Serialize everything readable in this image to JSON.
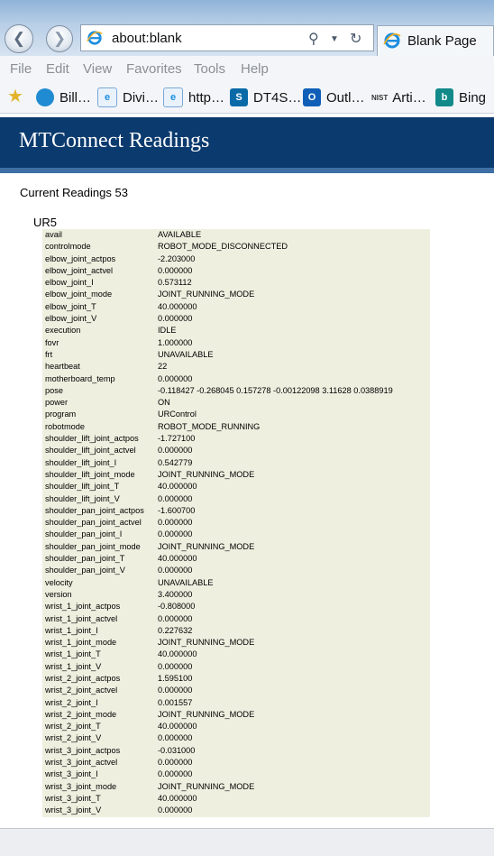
{
  "browser": {
    "address": "about:blank",
    "tab_title": "Blank Page",
    "menu": [
      "File",
      "Edit",
      "View",
      "Favorites",
      "Tools",
      "Help"
    ],
    "favorites": [
      {
        "label": "Bill…",
        "icon": "att-icon"
      },
      {
        "label": "Divi…",
        "icon": "ie-page-icon"
      },
      {
        "label": "http…",
        "icon": "ie-page-icon"
      },
      {
        "label": "DT4S…",
        "icon": "sharepoint-icon"
      },
      {
        "label": "Outl…",
        "icon": "outlook-icon"
      },
      {
        "label": "Arti…",
        "icon": "nist-icon"
      },
      {
        "label": "Bing",
        "icon": "bing-icon"
      }
    ],
    "nist_logo_text": "NIST"
  },
  "page": {
    "title": "MTConnect Readings",
    "current_readings": "Current Readings 53",
    "device": "UR5",
    "readings": [
      [
        "avail",
        "AVAILABLE"
      ],
      [
        "controlmode",
        "ROBOT_MODE_DISCONNECTED"
      ],
      [
        "elbow_joint_actpos",
        "-2.203000"
      ],
      [
        "elbow_joint_actvel",
        "0.000000"
      ],
      [
        "elbow_joint_I",
        "0.573112"
      ],
      [
        "elbow_joint_mode",
        "JOINT_RUNNING_MODE"
      ],
      [
        "elbow_joint_T",
        "40.000000"
      ],
      [
        "elbow_joint_V",
        "0.000000"
      ],
      [
        "execution",
        "IDLE"
      ],
      [
        "fovr",
        "1.000000"
      ],
      [
        "frt",
        "UNAVAILABLE"
      ],
      [
        "heartbeat",
        "22"
      ],
      [
        "motherboard_temp",
        "0.000000"
      ],
      [
        "pose",
        "-0.118427 -0.268045 0.157278 -0.00122098 3.11628 0.0388919"
      ],
      [
        "power",
        "ON"
      ],
      [
        "program",
        "URControl"
      ],
      [
        "robotmode",
        "ROBOT_MODE_RUNNING"
      ],
      [
        "shoulder_lift_joint_actpos",
        "-1.727100"
      ],
      [
        "shoulder_lift_joint_actvel",
        "0.000000"
      ],
      [
        "shoulder_lift_joint_I",
        "0.542779"
      ],
      [
        "shoulder_lift_joint_mode",
        "JOINT_RUNNING_MODE"
      ],
      [
        "shoulder_lift_joint_T",
        "40.000000"
      ],
      [
        "shoulder_lift_joint_V",
        "0.000000"
      ],
      [
        "shoulder_pan_joint_actpos",
        "-1.600700"
      ],
      [
        "shoulder_pan_joint_actvel",
        "0.000000"
      ],
      [
        "shoulder_pan_joint_I",
        "0.000000"
      ],
      [
        "shoulder_pan_joint_mode",
        "JOINT_RUNNING_MODE"
      ],
      [
        "shoulder_pan_joint_T",
        "40.000000"
      ],
      [
        "shoulder_pan_joint_V",
        "0.000000"
      ],
      [
        "velocity",
        "UNAVAILABLE"
      ],
      [
        "version",
        "3.400000"
      ],
      [
        "wrist_1_joint_actpos",
        "-0.808000"
      ],
      [
        "wrist_1_joint_actvel",
        "0.000000"
      ],
      [
        "wrist_1_joint_I",
        "0.227632"
      ],
      [
        "wrist_1_joint_mode",
        "JOINT_RUNNING_MODE"
      ],
      [
        "wrist_1_joint_T",
        "40.000000"
      ],
      [
        "wrist_1_joint_V",
        "0.000000"
      ],
      [
        "wrist_2_joint_actpos",
        "1.595100"
      ],
      [
        "wrist_2_joint_actvel",
        "0.000000"
      ],
      [
        "wrist_2_joint_I",
        "0.001557"
      ],
      [
        "wrist_2_joint_mode",
        "JOINT_RUNNING_MODE"
      ],
      [
        "wrist_2_joint_T",
        "40.000000"
      ],
      [
        "wrist_2_joint_V",
        "0.000000"
      ],
      [
        "wrist_3_joint_actpos",
        "-0.031000"
      ],
      [
        "wrist_3_joint_actvel",
        "0.000000"
      ],
      [
        "wrist_3_joint_I",
        "0.000000"
      ],
      [
        "wrist_3_joint_mode",
        "JOINT_RUNNING_MODE"
      ],
      [
        "wrist_3_joint_T",
        "40.000000"
      ],
      [
        "wrist_3_joint_V",
        "0.000000"
      ]
    ]
  },
  "colors": {
    "banner": "#0b3a6e",
    "banner_stripe": "#3e6fa5",
    "table_bg": "#eeefdf"
  }
}
